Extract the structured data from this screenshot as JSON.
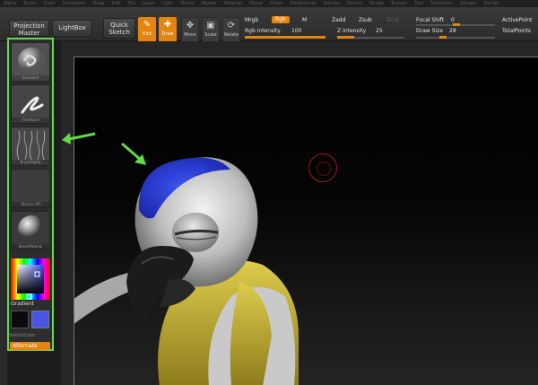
{
  "menu": [
    "Alpha",
    "Brush",
    "Color",
    "Document",
    "Draw",
    "Edit",
    "File",
    "Layer",
    "Light",
    "Macro",
    "Marker",
    "Material",
    "Movie",
    "Picker",
    "Preferences",
    "Render",
    "Stencil",
    "Stroke",
    "Texture",
    "Tool",
    "Transform",
    "Zplugin",
    "Zscript"
  ],
  "toolbar": {
    "projection_master": "Projection Master",
    "lightbox": "LightBox",
    "quick_sketch": "Quick Sketch",
    "edit": "Edit",
    "draw": "Draw",
    "move": "Move",
    "scale": "Scale",
    "rotate": "Rotate",
    "mrgb": "Mrgb",
    "rgb": "Rgb",
    "m": "M",
    "rgb_intensity_label": "Rgb Intensity",
    "rgb_intensity_value": "100",
    "rgb_intensity": 1.0,
    "zadd": "Zadd",
    "zsub": "Zsub",
    "zcut": "Zcut",
    "z_intensity_label": "Z Intensity",
    "z_intensity_value": "25",
    "z_intensity": 0.25,
    "focal_shift_label": "Focal Shift",
    "focal_shift_value": "0",
    "draw_size_label": "Draw Size",
    "draw_size_value": "28",
    "active_points": "ActivePoint",
    "total_points": "TotalPoints"
  },
  "tray": {
    "brush": "Standard",
    "stroke": "FreeHand",
    "alpha": "BrushAlpha",
    "texture": "Texture Off",
    "material": "BasicMaterial",
    "gradient": "Gradient",
    "switch_color": "SwitchColor",
    "alternate": "Alternate"
  },
  "colors": {
    "accent": "#e5840e",
    "highlight_outline": "#63d94a",
    "main_color": "#4a55e8",
    "secondary_color": "#0a0a0a"
  }
}
